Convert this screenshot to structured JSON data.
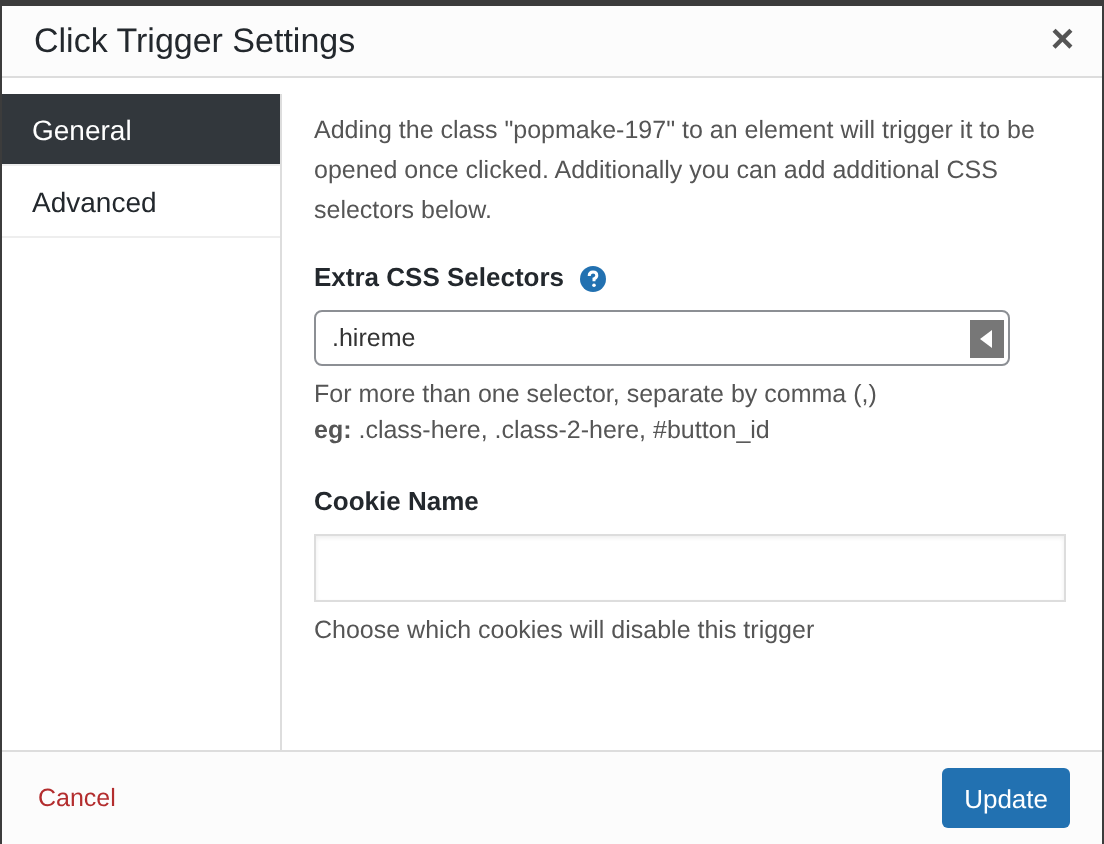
{
  "window": {
    "title": "Click Trigger Settings",
    "close": "×"
  },
  "tabs": [
    {
      "label": "General",
      "selected": true
    },
    {
      "label": "Advanced",
      "selected": false
    }
  ],
  "intro": "Adding the class \"popmake-197\" to an element will trigger it to be opened once clicked. Additionally you can add additional CSS selectors below.",
  "fields": [
    {
      "kind": "select",
      "label": "Extra CSS Selectors",
      "help": true,
      "value": ".hireme",
      "description": "For more than one selector, separate by comma (,)",
      "example": "**eg:** .class-here, .class-2-here, #button_id"
    },
    {
      "kind": "text",
      "label": "Cookie Name",
      "help": false,
      "description": "Choose which cookies will disable this trigger"
    }
  ],
  "footer": {
    "cancel": "Cancel",
    "submit": "Update"
  }
}
